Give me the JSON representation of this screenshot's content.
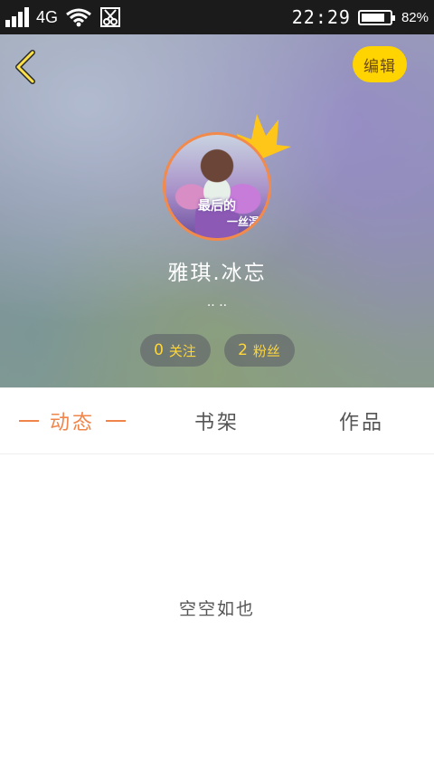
{
  "status_bar": {
    "network": "4G",
    "time": "22:29",
    "battery_percent": "82%",
    "battery_level": 0.82,
    "icons": [
      "signal-icon",
      "wifi-icon",
      "screenshot-icon"
    ]
  },
  "header": {
    "back_icon": "chevron-left-icon",
    "edit_label": "编辑",
    "avatar_caption_1": "最后的",
    "avatar_caption_2": "一丝温",
    "username": "雅琪.冰忘",
    "signature": "·· ··",
    "stats": {
      "follow_count": "0",
      "follow_label": "关注",
      "fans_count": "2",
      "fans_label": "粉丝"
    }
  },
  "tabs": [
    {
      "label": "动态",
      "active": true
    },
    {
      "label": "书架",
      "active": false
    },
    {
      "label": "作品",
      "active": false
    }
  ],
  "empty_state": {
    "text": "空空如也"
  },
  "colors": {
    "accent": "#f0854b",
    "edit_button": "#ffd400",
    "stat_text": "#ffd63a"
  }
}
